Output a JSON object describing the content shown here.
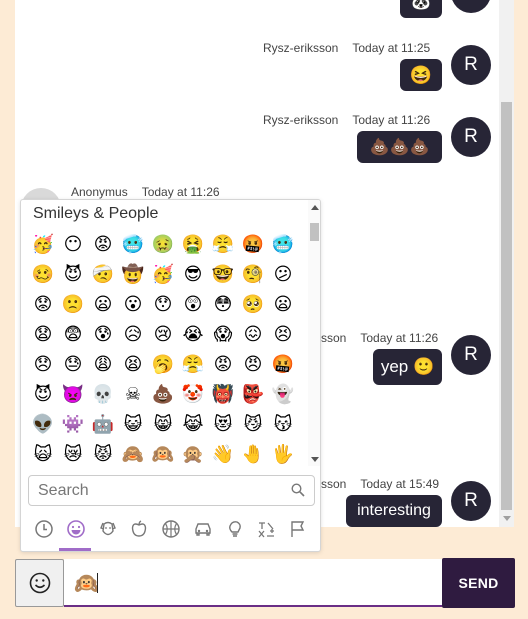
{
  "chat": {
    "messages": [
      {
        "author": "",
        "time": "",
        "text": "🐼",
        "avatar": ""
      },
      {
        "author": "Rysz-eriksson",
        "time": "Today at 11:25",
        "text": "😆",
        "avatar": "R"
      },
      {
        "author": "Rysz-eriksson",
        "time": "Today at 11:26",
        "text": "💩💩💩",
        "avatar": "R"
      },
      {
        "author": "Anonymus",
        "time": "Today at 11:26",
        "text": "",
        "avatar": ""
      },
      {
        "author": "sson",
        "time": "Today at 11:26",
        "text": "yep 🙂",
        "avatar": "R"
      },
      {
        "author": "sson",
        "time": "Today at 15:49",
        "text": "interesting",
        "avatar": "R"
      }
    ]
  },
  "picker": {
    "category_title": "Smileys & People",
    "emoji_rows": [
      [
        "🥳",
        "😶",
        "😡",
        "🥶",
        "🤢",
        "🤮",
        "😤",
        "🤬",
        "🥶"
      ],
      [
        "🥴",
        "😈",
        "🤕",
        "🤠",
        "🥳",
        "😎",
        "🤓",
        "🧐",
        "😕"
      ],
      [
        "😟",
        "🙁",
        "😦",
        "😮",
        "😯",
        "😲",
        "😳",
        "🥺",
        "😦"
      ],
      [
        "😧",
        "😨",
        "😰",
        "😥",
        "😢",
        "😭",
        "😱",
        "😖",
        "😣"
      ],
      [
        "😞",
        "😓",
        "😩",
        "😫",
        "🥱",
        "😤",
        "😡",
        "😠",
        "🤬"
      ],
      [
        "😈",
        "👿",
        "💀",
        "☠",
        "💩",
        "🤡",
        "👹",
        "👺",
        "👻"
      ],
      [
        "👽",
        "👾",
        "🤖",
        "😺",
        "😸",
        "😹",
        "😻",
        "😼",
        "😽"
      ],
      [
        "🙀",
        "😿",
        "😾",
        "🙈",
        "🙉",
        "🙊",
        "👋",
        "🤚",
        "🖐"
      ]
    ],
    "search": {
      "placeholder": "Search",
      "value": ""
    },
    "categories": [
      {
        "name": "recent",
        "icon": "clock-icon"
      },
      {
        "name": "smileys",
        "icon": "smiley-icon",
        "active": true
      },
      {
        "name": "animals",
        "icon": "dog-icon"
      },
      {
        "name": "food",
        "icon": "apple-icon"
      },
      {
        "name": "activities",
        "icon": "basketball-icon"
      },
      {
        "name": "travel",
        "icon": "car-icon"
      },
      {
        "name": "objects",
        "icon": "lightbulb-icon"
      },
      {
        "name": "symbols",
        "icon": "symbols-icon"
      },
      {
        "name": "flags",
        "icon": "flag-icon"
      }
    ],
    "accent_color": "#a06cc8"
  },
  "composer": {
    "message_value": "🙉",
    "send_label": "SEND"
  },
  "colors": {
    "page_background": "#fdebd5",
    "bubble": "#272536",
    "send_button": "#2f1b40",
    "input_underline": "#6a2e86"
  }
}
